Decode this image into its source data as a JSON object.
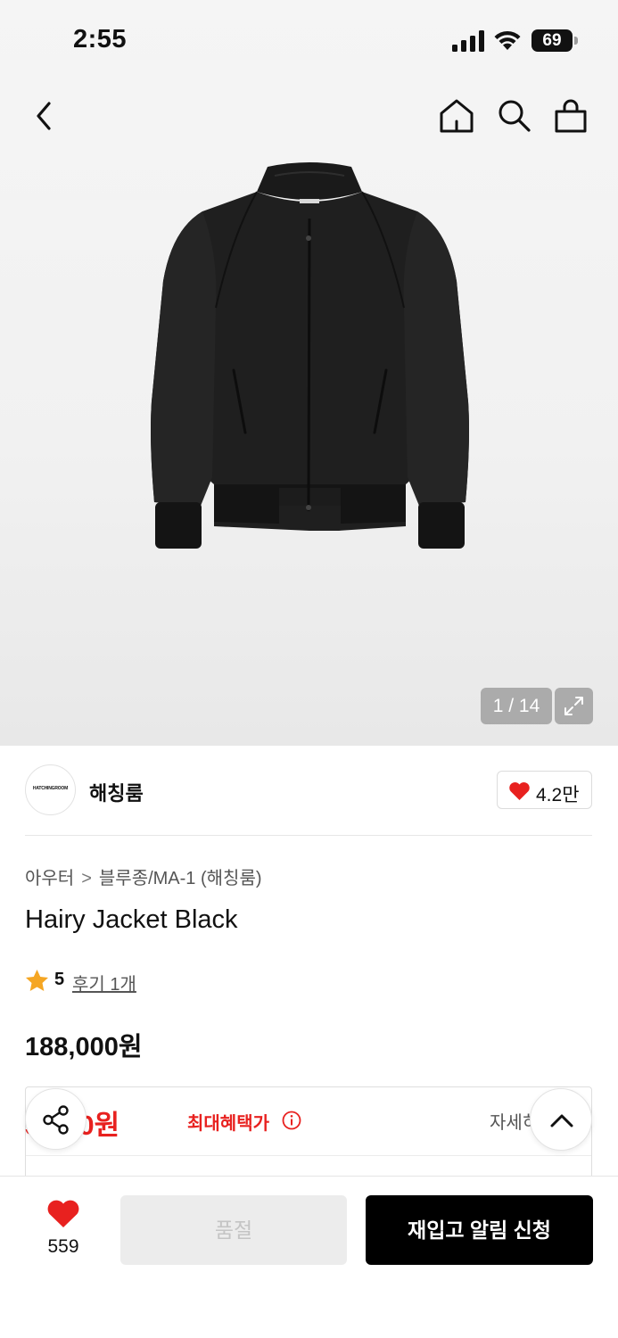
{
  "status_bar": {
    "time": "2:55",
    "battery": "69"
  },
  "nav": {
    "back_icon": "chevron-left-icon",
    "home_icon": "home-icon",
    "search_icon": "search-icon",
    "bag_icon": "shopping-bag-icon"
  },
  "gallery": {
    "counter": "1 / 14",
    "expand_icon": "expand-icon"
  },
  "brand": {
    "logo_text": "HATCHINGROOM",
    "name": "해칭룸",
    "likes": "4.2만"
  },
  "product": {
    "breadcrumb": [
      "아우터",
      "블루종/MA-1 (해칭룸)"
    ],
    "title": "Hairy Jacket Black",
    "rating": "5",
    "reviews": "후기 1개",
    "price": "188,000원"
  },
  "benefit": {
    "price": "3,000원",
    "label": "최대혜택가",
    "detail": "자세히"
  },
  "bottom": {
    "wish_count": "559",
    "soldout": "품절",
    "restock": "재입고 알림 신청"
  },
  "colors": {
    "accent_red": "#e8211f",
    "primary_black": "#000000"
  }
}
